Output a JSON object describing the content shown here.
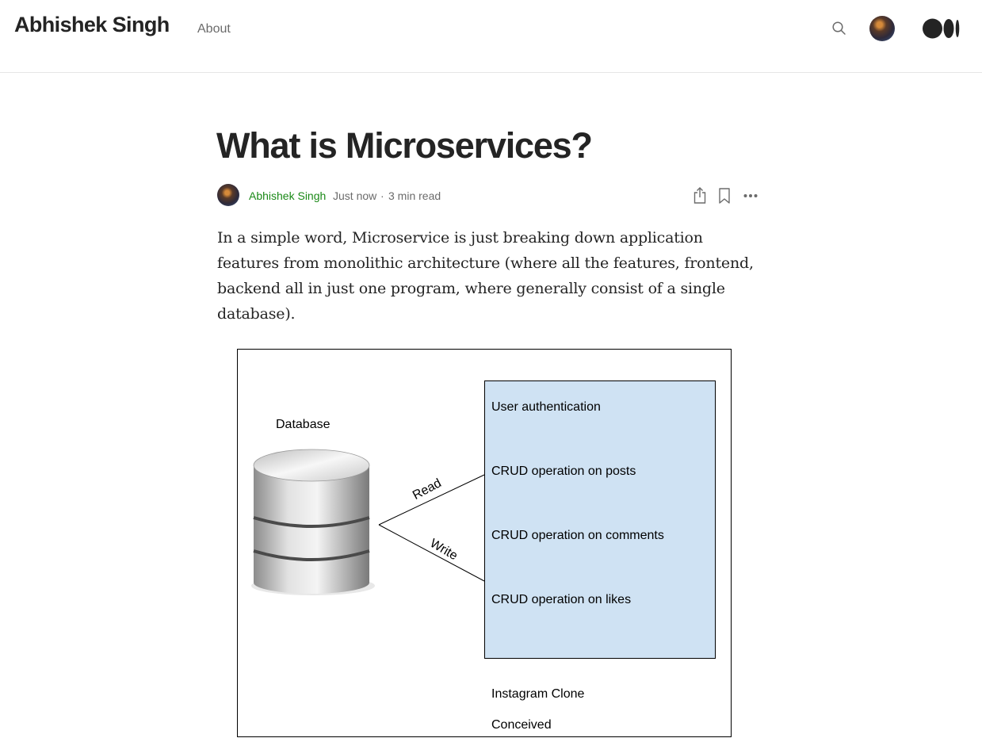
{
  "header": {
    "blog_name": "Abhishek Singh",
    "about_label": "About",
    "search_icon": "search-icon",
    "avatar_icon": "user-avatar",
    "logo_icon": "medium-logo"
  },
  "article": {
    "title": "What is Microservices?",
    "author": "Abhishek Singh",
    "published": "Just now",
    "separator": "·",
    "read_time": "3 min read",
    "actions": [
      "share-icon",
      "bookmark-icon",
      "more-icon"
    ],
    "paragraph": "In a simple word, Microservice is just breaking down application features from monolithic architecture (where all the features, frontend, backend all in just one program, where generally consist of a single database)."
  },
  "diagram": {
    "database_label": "Database",
    "edge_read": "Read",
    "edge_write": "Write",
    "features": [
      "User authentication",
      "CRUD operation on posts",
      "CRUD operation on comments",
      "CRUD operation on likes"
    ],
    "app_name": "Instagram Clone",
    "app_subtitle": "Conceived",
    "features_box_color": "#cfe2f3"
  },
  "colors": {
    "text": "#242424",
    "muted": "#6b6b6b",
    "author_link": "#1a8917",
    "divider": "#e6e6e6"
  }
}
